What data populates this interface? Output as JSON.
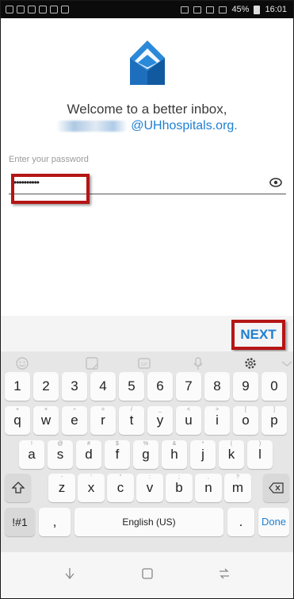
{
  "status_bar": {
    "battery_text": "45%",
    "time": "16:01"
  },
  "welcome_text": "Welcome to a better inbox,",
  "email_domain": "@UHhospitals.org.",
  "password": {
    "label": "Enter your password",
    "value": "••••••••••"
  },
  "next_label": "NEXT",
  "keyboard": {
    "row1": [
      "1",
      "2",
      "3",
      "4",
      "5",
      "6",
      "7",
      "8",
      "9",
      "0"
    ],
    "row2": [
      "q",
      "w",
      "e",
      "r",
      "t",
      "y",
      "u",
      "i",
      "o",
      "p"
    ],
    "row2_hints": [
      "+",
      "×",
      "÷",
      "=",
      "/",
      "_",
      "<",
      ">",
      "[",
      "]"
    ],
    "row3": [
      "a",
      "s",
      "d",
      "f",
      "g",
      "h",
      "j",
      "k",
      "l"
    ],
    "row3_hints": [
      "!",
      "@",
      "#",
      "$",
      "%",
      "&",
      "*",
      "(",
      ")"
    ],
    "row4": [
      "z",
      "x",
      "c",
      "v",
      "b",
      "n",
      "m"
    ],
    "row4_hints": [
      "-",
      "'",
      "\"",
      ":",
      ";",
      ",",
      "?"
    ],
    "symbols_label": "!#1",
    "comma_label": ",",
    "space_label": "English (US)",
    "period_label": ".",
    "done_label": "Done"
  },
  "colors": {
    "accent": "#1e7fd2",
    "highlight": "#b51515"
  }
}
